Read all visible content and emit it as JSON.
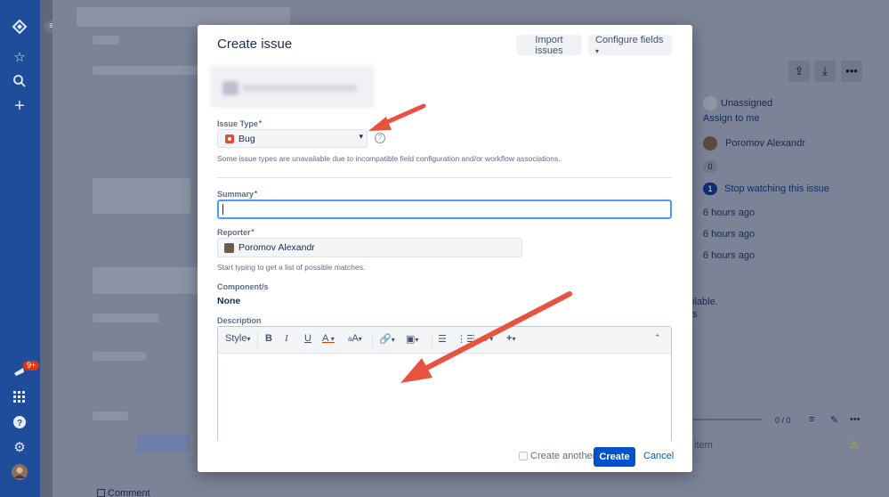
{
  "modal": {
    "title": "Create issue",
    "import_label": "Import issues",
    "configure_label": "Configure fields",
    "issue_type": {
      "label": "Issue Type",
      "value": "Bug",
      "help": "Some issue types are unavailable due to incompatible field configuration and/or workflow associations."
    },
    "summary": {
      "label": "Summary",
      "value": ""
    },
    "reporter": {
      "label": "Reporter",
      "value": "Poromov Alexandr",
      "help": "Start typing to get a list of possible matches."
    },
    "components": {
      "label": "Component/s",
      "value": "None"
    },
    "description": {
      "label": "Description",
      "toolbar": {
        "style": "Style",
        "bold": "B",
        "italic": "I",
        "underline": "U",
        "color": "A",
        "text_size": "ᵃA"
      }
    },
    "footer": {
      "create_another": "Create another",
      "create": "Create",
      "cancel": "Cancel"
    }
  },
  "background": {
    "assignee": "Unassigned",
    "assign_to_me": "Assign to me",
    "reporter": "Poromov Alexandr",
    "votes": "0",
    "watchers": "1",
    "stop_watching": "Stop watching this issue",
    "created": "6 hours ago",
    "updated": "6 hours ago",
    "resolved": "6 hours ago",
    "partial_text_1": "ilable.",
    "partial_text_2": "s",
    "progress": "0 / 0",
    "partial_item": "item",
    "comment": "Comment"
  },
  "nav": {
    "notification_count": "9+"
  },
  "colors": {
    "primary": "#0052cc",
    "nav_bg": "#1f4d9c",
    "required": "#de350b",
    "focus": "#4c9aff",
    "arrow": "#e8533f"
  }
}
